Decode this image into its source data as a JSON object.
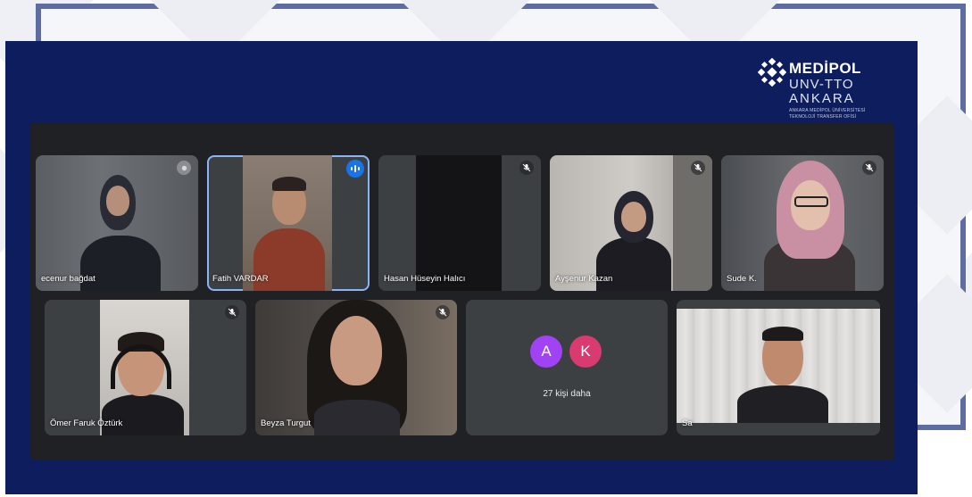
{
  "logo": {
    "brand": "MEDİPOL",
    "line2": "UNV-TTO",
    "line3": "ANKARA",
    "sub1": "ANKARA MEDİPOL ÜNİVERSİTESİ",
    "sub2": "TEKNOLOJİ TRANSFER OFİSİ"
  },
  "colors": {
    "panel": "#0e1d5d",
    "frame": "#5d6da2",
    "meeting_bg": "#202124",
    "tile_bg": "#3c4043",
    "active_outline": "#8ab4f8",
    "speaking": "#1a73e8"
  },
  "participants": [
    {
      "name": "ecenur bağdat",
      "mic_icon": "mic-off-icon"
    },
    {
      "name": "Fatih VARDAR",
      "mic_icon": "speaking-icon",
      "active": true
    },
    {
      "name": "Hasan Hüseyin Halıcı",
      "mic_icon": "mic-off-icon"
    },
    {
      "name": "Ayşenur Kazan",
      "mic_icon": "mic-off-icon"
    },
    {
      "name": "Sude K.",
      "mic_icon": "mic-off-icon"
    },
    {
      "name": "Ömer Faruk Öztürk",
      "mic_icon": "mic-off-icon"
    },
    {
      "name": "Beyza Turgut",
      "mic_icon": "mic-off-icon"
    },
    {
      "name": "Sa",
      "mic_icon": ""
    }
  ],
  "more": {
    "avatars": [
      {
        "letter": "A",
        "color": "#a142f4"
      },
      {
        "letter": "K",
        "color": "#d93a6f"
      }
    ],
    "label": "27 kişi daha"
  }
}
